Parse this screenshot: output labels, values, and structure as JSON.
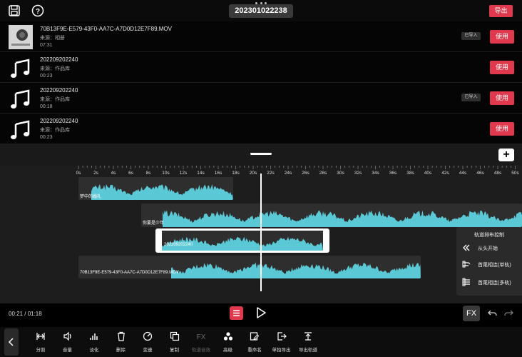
{
  "topbar": {
    "project_title": "202301022238",
    "export_label": "导出",
    "save_icon": "save-icon",
    "help_icon": "help-icon"
  },
  "media": {
    "items": [
      {
        "name": "70B13F9E-E579-43F0-AA7C-A7D0D12E7F89.MOV",
        "source": "来源：相册",
        "duration": "07:31",
        "imported": "已导入",
        "use_label": "使用",
        "thumb": "video"
      },
      {
        "name": "202209202240",
        "source": "来源：作品库",
        "duration": "00:23",
        "imported": "",
        "use_label": "使用",
        "thumb": "music"
      },
      {
        "name": "202209202240",
        "source": "来源：作品库",
        "duration": "00:18",
        "imported": "已导入",
        "use_label": "使用",
        "thumb": "music"
      },
      {
        "name": "202209202240",
        "source": "来源：作品库",
        "duration": "00:23",
        "imported": "",
        "use_label": "使用",
        "thumb": "music"
      }
    ]
  },
  "timeline": {
    "ruler_ticks": [
      "0s",
      "2s",
      "4s",
      "6s",
      "8s",
      "10s",
      "12s",
      "14s",
      "16s",
      "18s",
      "20s",
      "22s",
      "24s",
      "26s",
      "28s",
      "30s",
      "32s",
      "34s",
      "36s",
      "38s",
      "40s",
      "42s",
      "44s",
      "46s",
      "48s",
      "50s"
    ],
    "clips": [
      {
        "label": "梦中的婚礼"
      },
      {
        "label": "你要是少年"
      },
      {
        "label": "202209202240"
      },
      {
        "label": "70B13F9E-E579-43F0-AA7C-A7D0D12E7F89.MOV"
      }
    ]
  },
  "track_panel": {
    "title": "轨道排布控制",
    "items": [
      {
        "label": "从头开始",
        "icon": "rewind-icon"
      },
      {
        "label": "首尾相连(单轨)",
        "icon": "single-track-icon"
      },
      {
        "label": "首尾相连(多轨)",
        "icon": "multi-track-icon"
      }
    ]
  },
  "controls": {
    "time": "00:21 / 01:18",
    "fx_label": "FX"
  },
  "toolbar": {
    "tools": [
      {
        "label": "分割",
        "icon": "split-icon",
        "enabled": true
      },
      {
        "label": "音量",
        "icon": "volume-icon",
        "enabled": true
      },
      {
        "label": "淡化",
        "icon": "fade-icon",
        "enabled": true
      },
      {
        "label": "删除",
        "icon": "trash-icon",
        "enabled": true
      },
      {
        "label": "变速",
        "icon": "speed-icon",
        "enabled": true
      },
      {
        "label": "复制",
        "icon": "copy-icon",
        "enabled": true
      },
      {
        "label": "轨道音效",
        "icon": "fx-icon",
        "enabled": false
      },
      {
        "label": "高级",
        "icon": "advanced-icon",
        "enabled": true
      },
      {
        "label": "重命名",
        "icon": "rename-icon",
        "enabled": true
      },
      {
        "label": "单独导出",
        "icon": "export-single-icon",
        "enabled": true
      },
      {
        "label": "导出轨道",
        "icon": "export-track-icon",
        "enabled": true
      }
    ]
  },
  "colors": {
    "accent": "#e0384d",
    "wave": "#5bc8d6"
  }
}
